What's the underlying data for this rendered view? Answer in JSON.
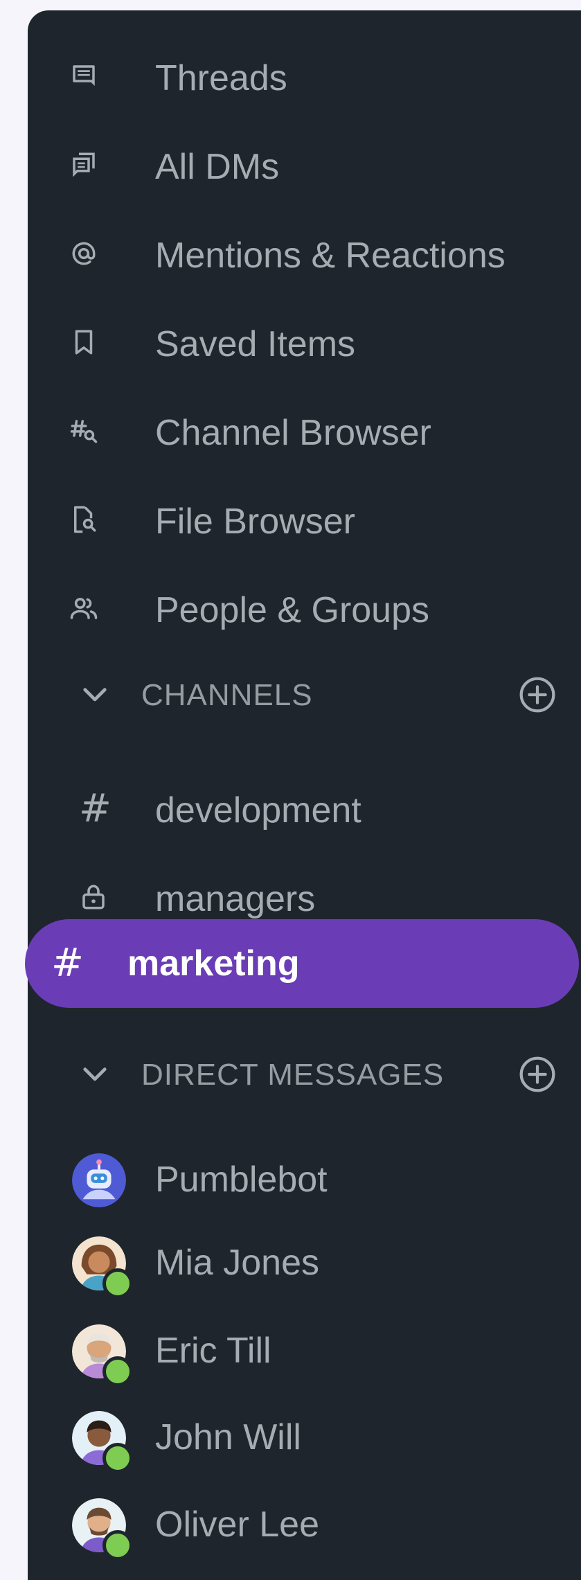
{
  "nav": [
    {
      "label": "Threads",
      "icon": "threads-icon"
    },
    {
      "label": "All DMs",
      "icon": "all-dms-icon"
    },
    {
      "label": "Mentions & Reactions",
      "icon": "at-sign-icon"
    },
    {
      "label": "Saved Items",
      "icon": "bookmark-icon"
    },
    {
      "label": "Channel Browser",
      "icon": "channel-search-icon"
    },
    {
      "label": "File Browser",
      "icon": "file-search-icon"
    },
    {
      "label": "People & Groups",
      "icon": "people-icon"
    }
  ],
  "channels": {
    "title": "CHANNELS",
    "items": [
      {
        "label": "development",
        "icon": "hash-icon"
      },
      {
        "label": "managers",
        "icon": "lock-icon"
      },
      {
        "label": "marketing",
        "icon": "hash-icon",
        "active": true
      }
    ]
  },
  "direct_messages": {
    "title": "DIRECT MESSAGES",
    "items": [
      {
        "label": "Pumblebot",
        "avatar": "bot-avatar",
        "online": false
      },
      {
        "label": "Mia Jones",
        "avatar": "user-avatar",
        "online": true
      },
      {
        "label": "Eric Till",
        "avatar": "user-avatar",
        "online": true
      },
      {
        "label": "John Will",
        "avatar": "user-avatar",
        "online": true
      },
      {
        "label": "Oliver Lee",
        "avatar": "user-avatar",
        "online": true
      }
    ]
  },
  "colors": {
    "sidebar_bg": "#1f252c",
    "active_bg": "#6a3db7",
    "text": "#a7acb3",
    "online": "#7fcc52"
  }
}
